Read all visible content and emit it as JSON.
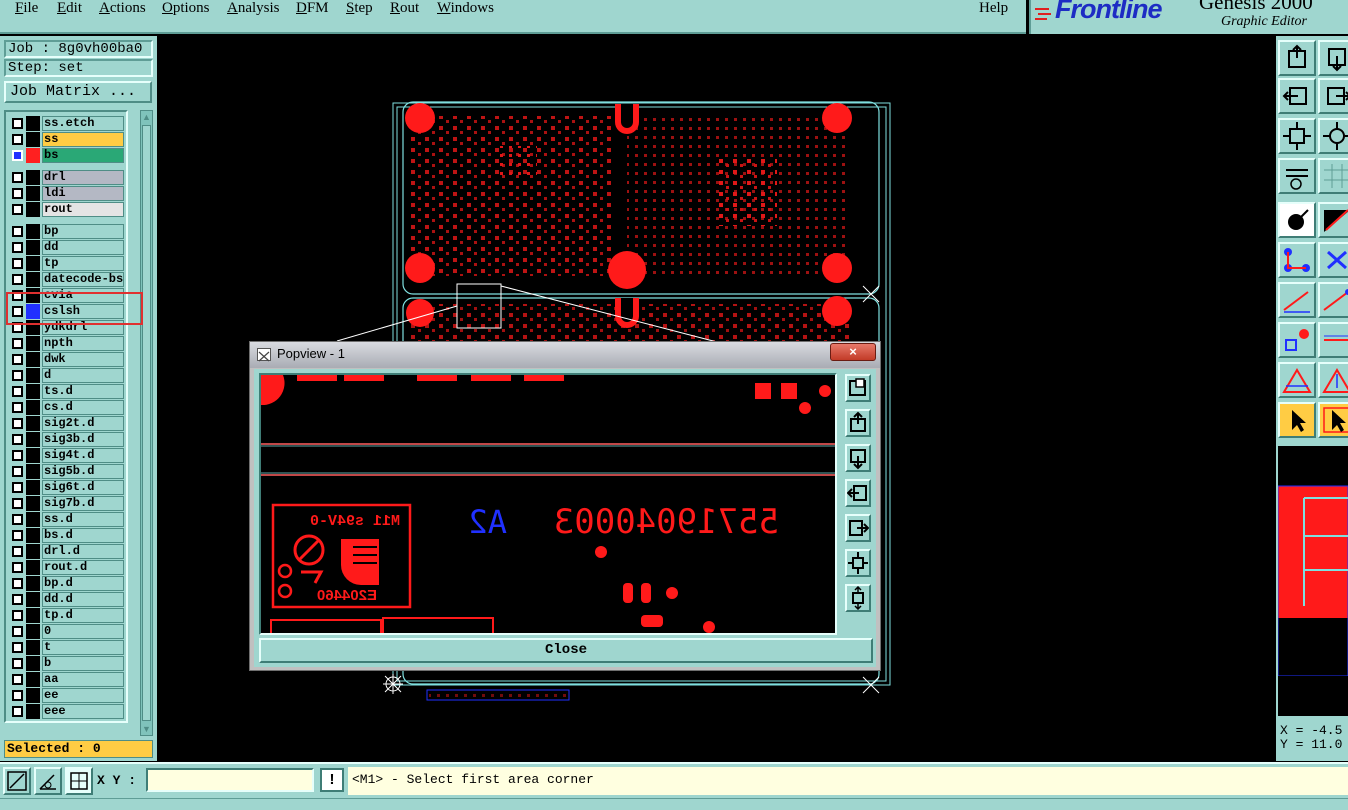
{
  "menu": {
    "items": [
      "File",
      "Edit",
      "Actions",
      "Options",
      "Analysis",
      "DFM",
      "Step",
      "Rout",
      "Windows"
    ],
    "help": "Help"
  },
  "brand": {
    "logo": "Frontline",
    "product": "Genesis 2000",
    "subtitle": "Graphic Editor"
  },
  "left_panel": {
    "job": "Job : 8g0vh00ba0",
    "step": "Step: set",
    "job_matrix": "Job Matrix ...",
    "selected": "Selected : 0"
  },
  "layers": [
    {
      "name": "ss.etch",
      "color": "#9fd6cf",
      "swatch": "#000000"
    },
    {
      "name": "ss",
      "color": "#ffcc44",
      "swatch": "#000000"
    },
    {
      "name": "bs",
      "color": "#2aa876",
      "swatch": "#ff2020",
      "active": true
    },
    {
      "name": "drl",
      "color": "#b4b8c4",
      "swatch": "#000000"
    },
    {
      "name": "ldi",
      "color": "#b4b8c4",
      "swatch": "#000000"
    },
    {
      "name": "rout",
      "color": "#e4e4e4",
      "swatch": "#000000"
    },
    {
      "name": "bp",
      "color": "#9fd6cf",
      "swatch": "#000000"
    },
    {
      "name": "dd",
      "color": "#9fd6cf",
      "swatch": "#000000"
    },
    {
      "name": "tp",
      "color": "#9fd6cf",
      "swatch": "#000000"
    },
    {
      "name": "datecode-bs",
      "color": "#9fd6cf",
      "swatch": "#000000"
    },
    {
      "name": "cvia",
      "color": "#9fd6cf",
      "swatch": "#000000"
    },
    {
      "name": "cslsh",
      "color": "#9fd6cf",
      "swatch": "#2030ff"
    },
    {
      "name": "ydkdrl",
      "color": "#9fd6cf",
      "swatch": "#000000"
    },
    {
      "name": "npth",
      "color": "#9fd6cf",
      "swatch": "#000000"
    },
    {
      "name": "dwk",
      "color": "#9fd6cf",
      "swatch": "#000000"
    },
    {
      "name": "d",
      "color": "#9fd6cf",
      "swatch": "#000000"
    },
    {
      "name": "ts.d",
      "color": "#9fd6cf",
      "swatch": "#000000"
    },
    {
      "name": "cs.d",
      "color": "#9fd6cf",
      "swatch": "#000000"
    },
    {
      "name": "sig2t.d",
      "color": "#9fd6cf",
      "swatch": "#000000"
    },
    {
      "name": "sig3b.d",
      "color": "#9fd6cf",
      "swatch": "#000000"
    },
    {
      "name": "sig4t.d",
      "color": "#9fd6cf",
      "swatch": "#000000"
    },
    {
      "name": "sig5b.d",
      "color": "#9fd6cf",
      "swatch": "#000000"
    },
    {
      "name": "sig6t.d",
      "color": "#9fd6cf",
      "swatch": "#000000"
    },
    {
      "name": "sig7b.d",
      "color": "#9fd6cf",
      "swatch": "#000000"
    },
    {
      "name": "ss.d",
      "color": "#9fd6cf",
      "swatch": "#000000"
    },
    {
      "name": "bs.d",
      "color": "#9fd6cf",
      "swatch": "#000000"
    },
    {
      "name": "drl.d",
      "color": "#9fd6cf",
      "swatch": "#000000"
    },
    {
      "name": "rout.d",
      "color": "#9fd6cf",
      "swatch": "#000000"
    },
    {
      "name": "bp.d",
      "color": "#9fd6cf",
      "swatch": "#000000"
    },
    {
      "name": "dd.d",
      "color": "#9fd6cf",
      "swatch": "#000000"
    },
    {
      "name": "tp.d",
      "color": "#9fd6cf",
      "swatch": "#000000"
    },
    {
      "name": "0",
      "color": "#9fd6cf",
      "swatch": "#000000"
    },
    {
      "name": "t",
      "color": "#9fd6cf",
      "swatch": "#000000"
    },
    {
      "name": "b",
      "color": "#9fd6cf",
      "swatch": "#000000"
    },
    {
      "name": "aa",
      "color": "#9fd6cf",
      "swatch": "#000000"
    },
    {
      "name": "ee",
      "color": "#9fd6cf",
      "swatch": "#000000"
    },
    {
      "name": "eee",
      "color": "#9fd6cf",
      "swatch": "#000000"
    }
  ],
  "board": {
    "part_number": "55719040003",
    "revision": "A2",
    "marking": "M11 s94V-0",
    "marking_code": "E204460"
  },
  "popview": {
    "title": "Popview - 1",
    "close_label": "Close",
    "close_x": "×"
  },
  "status": {
    "xy_label": "X Y :",
    "xy_value": "",
    "warning": "!",
    "prompt": "<M1> - Select first area corner",
    "coord_x": "X = -4.5",
    "coord_y": "Y = 11.0"
  },
  "colors": {
    "panel": "#9fd6cf",
    "copper": "#ff1a1a",
    "outline": "#7fe0e0",
    "blue_text": "#2030ff"
  },
  "icons": {
    "right_toolbar": [
      "zoom-top-icon",
      "zoom-bottom-icon",
      "pan-left-icon",
      "pan-right-icon",
      "fit-icon",
      "center-icon",
      "measure-icon",
      "grid-icon",
      "snap-point-icon",
      "snap-edge-icon",
      "net-icon",
      "cross-icon",
      "line-red-icon",
      "line-blue-icon",
      "pad-icon",
      "dash-icon",
      "triangle-icon",
      "triangle-arrow-icon",
      "pointer-icon",
      "pointer-box-icon"
    ],
    "popview_side": [
      "zoom-window-icon",
      "pan-up-icon",
      "pan-down-icon",
      "pan-left-icon",
      "pan-right-icon",
      "fit-icon",
      "center-icon"
    ]
  }
}
